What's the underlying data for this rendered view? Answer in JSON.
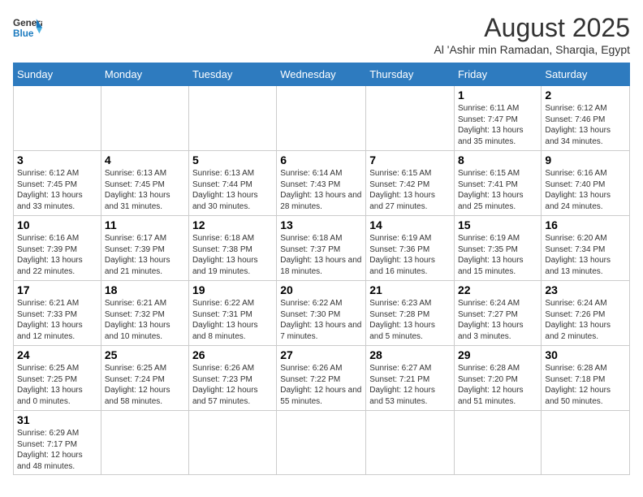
{
  "logo": {
    "line1": "General",
    "line2": "Blue"
  },
  "calendar": {
    "title": "August 2025",
    "subtitle": "Al 'Ashir min Ramadan, Sharqia, Egypt"
  },
  "weekdays": [
    "Sunday",
    "Monday",
    "Tuesday",
    "Wednesday",
    "Thursday",
    "Friday",
    "Saturday"
  ],
  "weeks": [
    [
      {
        "day": "",
        "info": ""
      },
      {
        "day": "",
        "info": ""
      },
      {
        "day": "",
        "info": ""
      },
      {
        "day": "",
        "info": ""
      },
      {
        "day": "",
        "info": ""
      },
      {
        "day": "1",
        "info": "Sunrise: 6:11 AM\nSunset: 7:47 PM\nDaylight: 13 hours and 35 minutes."
      },
      {
        "day": "2",
        "info": "Sunrise: 6:12 AM\nSunset: 7:46 PM\nDaylight: 13 hours and 34 minutes."
      }
    ],
    [
      {
        "day": "3",
        "info": "Sunrise: 6:12 AM\nSunset: 7:45 PM\nDaylight: 13 hours and 33 minutes."
      },
      {
        "day": "4",
        "info": "Sunrise: 6:13 AM\nSunset: 7:45 PM\nDaylight: 13 hours and 31 minutes."
      },
      {
        "day": "5",
        "info": "Sunrise: 6:13 AM\nSunset: 7:44 PM\nDaylight: 13 hours and 30 minutes."
      },
      {
        "day": "6",
        "info": "Sunrise: 6:14 AM\nSunset: 7:43 PM\nDaylight: 13 hours and 28 minutes."
      },
      {
        "day": "7",
        "info": "Sunrise: 6:15 AM\nSunset: 7:42 PM\nDaylight: 13 hours and 27 minutes."
      },
      {
        "day": "8",
        "info": "Sunrise: 6:15 AM\nSunset: 7:41 PM\nDaylight: 13 hours and 25 minutes."
      },
      {
        "day": "9",
        "info": "Sunrise: 6:16 AM\nSunset: 7:40 PM\nDaylight: 13 hours and 24 minutes."
      }
    ],
    [
      {
        "day": "10",
        "info": "Sunrise: 6:16 AM\nSunset: 7:39 PM\nDaylight: 13 hours and 22 minutes."
      },
      {
        "day": "11",
        "info": "Sunrise: 6:17 AM\nSunset: 7:39 PM\nDaylight: 13 hours and 21 minutes."
      },
      {
        "day": "12",
        "info": "Sunrise: 6:18 AM\nSunset: 7:38 PM\nDaylight: 13 hours and 19 minutes."
      },
      {
        "day": "13",
        "info": "Sunrise: 6:18 AM\nSunset: 7:37 PM\nDaylight: 13 hours and 18 minutes."
      },
      {
        "day": "14",
        "info": "Sunrise: 6:19 AM\nSunset: 7:36 PM\nDaylight: 13 hours and 16 minutes."
      },
      {
        "day": "15",
        "info": "Sunrise: 6:19 AM\nSunset: 7:35 PM\nDaylight: 13 hours and 15 minutes."
      },
      {
        "day": "16",
        "info": "Sunrise: 6:20 AM\nSunset: 7:34 PM\nDaylight: 13 hours and 13 minutes."
      }
    ],
    [
      {
        "day": "17",
        "info": "Sunrise: 6:21 AM\nSunset: 7:33 PM\nDaylight: 13 hours and 12 minutes."
      },
      {
        "day": "18",
        "info": "Sunrise: 6:21 AM\nSunset: 7:32 PM\nDaylight: 13 hours and 10 minutes."
      },
      {
        "day": "19",
        "info": "Sunrise: 6:22 AM\nSunset: 7:31 PM\nDaylight: 13 hours and 8 minutes."
      },
      {
        "day": "20",
        "info": "Sunrise: 6:22 AM\nSunset: 7:30 PM\nDaylight: 13 hours and 7 minutes."
      },
      {
        "day": "21",
        "info": "Sunrise: 6:23 AM\nSunset: 7:28 PM\nDaylight: 13 hours and 5 minutes."
      },
      {
        "day": "22",
        "info": "Sunrise: 6:24 AM\nSunset: 7:27 PM\nDaylight: 13 hours and 3 minutes."
      },
      {
        "day": "23",
        "info": "Sunrise: 6:24 AM\nSunset: 7:26 PM\nDaylight: 13 hours and 2 minutes."
      }
    ],
    [
      {
        "day": "24",
        "info": "Sunrise: 6:25 AM\nSunset: 7:25 PM\nDaylight: 13 hours and 0 minutes."
      },
      {
        "day": "25",
        "info": "Sunrise: 6:25 AM\nSunset: 7:24 PM\nDaylight: 12 hours and 58 minutes."
      },
      {
        "day": "26",
        "info": "Sunrise: 6:26 AM\nSunset: 7:23 PM\nDaylight: 12 hours and 57 minutes."
      },
      {
        "day": "27",
        "info": "Sunrise: 6:26 AM\nSunset: 7:22 PM\nDaylight: 12 hours and 55 minutes."
      },
      {
        "day": "28",
        "info": "Sunrise: 6:27 AM\nSunset: 7:21 PM\nDaylight: 12 hours and 53 minutes."
      },
      {
        "day": "29",
        "info": "Sunrise: 6:28 AM\nSunset: 7:20 PM\nDaylight: 12 hours and 51 minutes."
      },
      {
        "day": "30",
        "info": "Sunrise: 6:28 AM\nSunset: 7:18 PM\nDaylight: 12 hours and 50 minutes."
      }
    ],
    [
      {
        "day": "31",
        "info": "Sunrise: 6:29 AM\nSunset: 7:17 PM\nDaylight: 12 hours and 48 minutes."
      },
      {
        "day": "",
        "info": ""
      },
      {
        "day": "",
        "info": ""
      },
      {
        "day": "",
        "info": ""
      },
      {
        "day": "",
        "info": ""
      },
      {
        "day": "",
        "info": ""
      },
      {
        "day": "",
        "info": ""
      }
    ]
  ]
}
